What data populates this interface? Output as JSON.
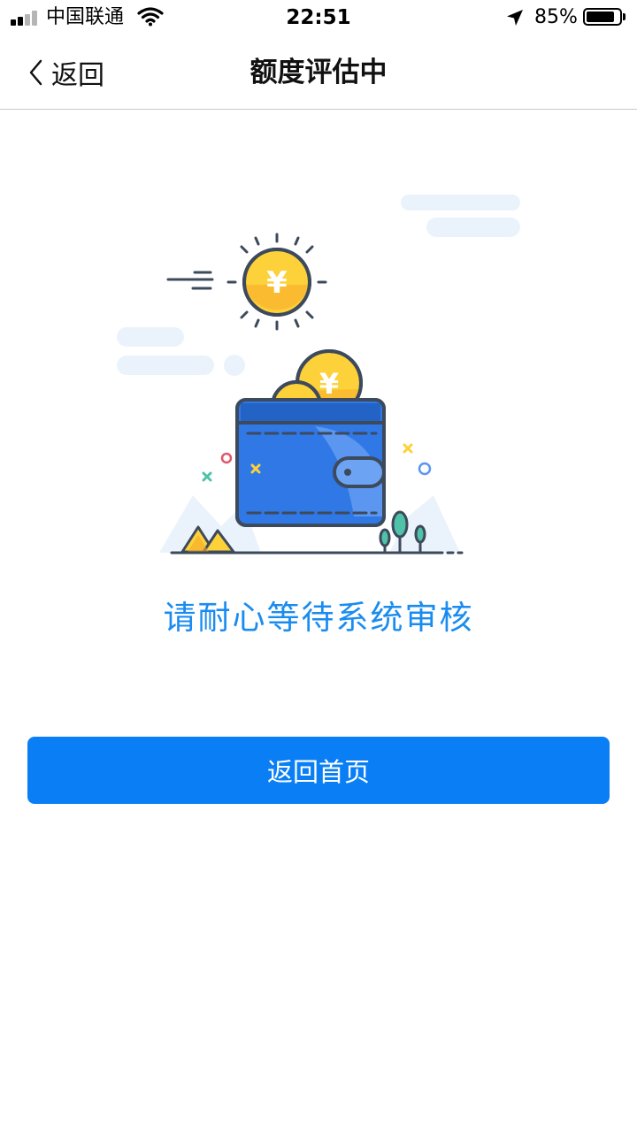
{
  "status_bar": {
    "carrier": "中国联通",
    "time": "22:51",
    "battery": "85%",
    "battery_level": 0.85,
    "icons": [
      "signal-icon",
      "wifi-icon",
      "location-arrow-icon",
      "battery-icon"
    ]
  },
  "nav": {
    "back_label": "返回",
    "title": "额度评估中"
  },
  "illustration": {
    "currency_symbol": "¥",
    "icons": [
      "sun-coin-icon",
      "wallet-icon",
      "coin-icon"
    ]
  },
  "message": "请耐心等待系统审核",
  "home_button": {
    "label": "返回首页"
  },
  "colors": {
    "accent": "#0a7ff5",
    "message_text": "#1a8cf0",
    "wallet_blue": "#2f78e6",
    "coin_gold": "#fcd13a"
  }
}
